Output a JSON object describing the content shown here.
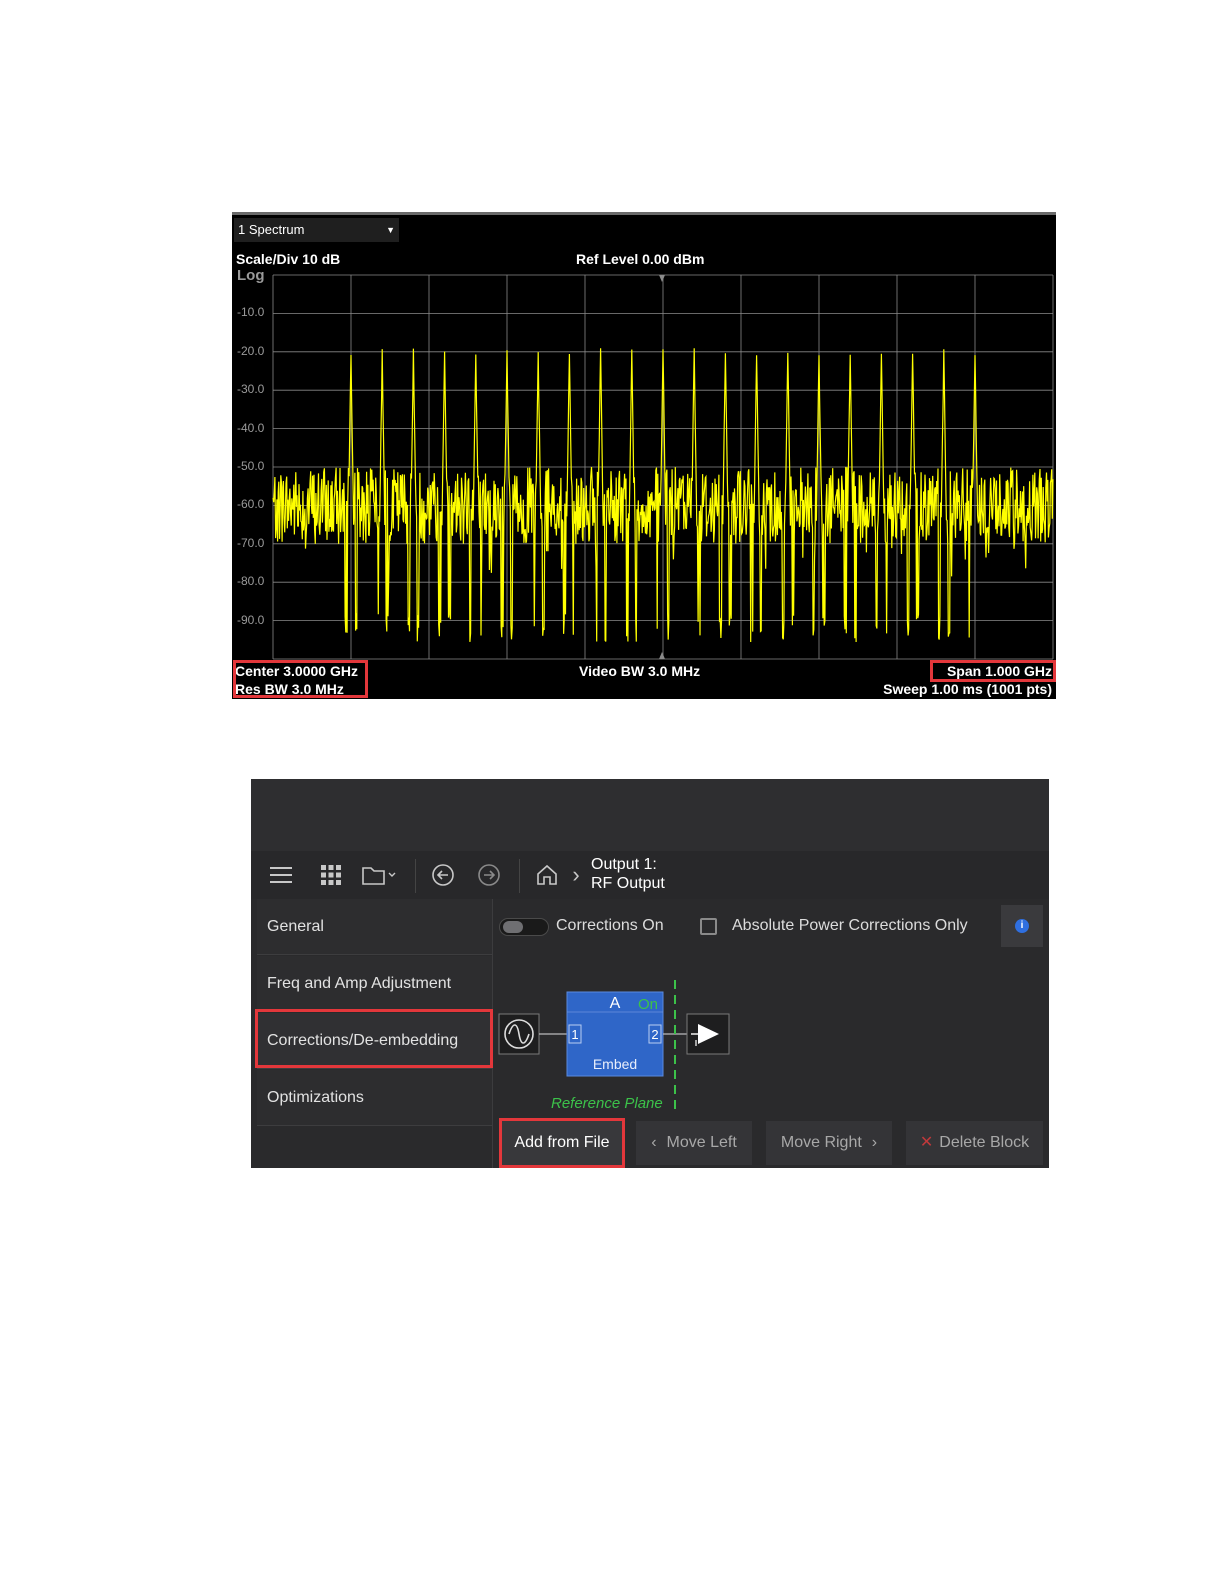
{
  "spectrum": {
    "window_label": "1 Spectrum",
    "scale_label": "Scale/Div 10 dB",
    "log_label": "Log",
    "ref_level_label": "Ref Level 0.00 dBm",
    "y_ticks": [
      "-10.0",
      "-20.0",
      "-30.0",
      "-40.0",
      "-50.0",
      "-60.0",
      "-70.0",
      "-80.0",
      "-90.0"
    ],
    "center_label": "Center 3.0000 GHz",
    "res_bw_label": "Res BW 3.0 MHz",
    "video_bw_label": "Video BW 3.0 MHz",
    "span_label": "Span 1.000 GHz",
    "sweep_label": "Sweep 1.00 ms (1001 pts)",
    "trace_color": "#ffff00",
    "grid_color": "#8a8a8a",
    "highlight_color": "#e3373b"
  },
  "chart_data": {
    "type": "line",
    "ylim": [
      -100,
      0
    ],
    "xlim": [
      2.5,
      3.5
    ],
    "x_unit": "GHz",
    "y_unit": "dBm",
    "noise_floor_dbm": [
      -70,
      -90
    ],
    "tones": {
      "count": 21,
      "peak_dbm": -21,
      "x_ghz": [
        2.6,
        2.64,
        2.68,
        2.72,
        2.76,
        2.8,
        2.84,
        2.88,
        2.92,
        2.96,
        3.0,
        3.04,
        3.08,
        3.12,
        3.16,
        3.2,
        3.24,
        3.28,
        3.32,
        3.36,
        3.4
      ]
    }
  },
  "corrections_ui": {
    "toolbar": {
      "menu_icon": "hamburger-menu-icon",
      "apps_icon": "apps-grid-icon",
      "folder_icon": "folder-icon",
      "back_icon": "back-arrow-icon",
      "forward_icon": "forward-arrow-icon",
      "home_icon": "home-icon",
      "breadcrumb_chevron": "›",
      "title_line1": "Output 1:",
      "title_line2": "RF Output"
    },
    "sidebar": {
      "items": [
        {
          "label": "General"
        },
        {
          "label": "Freq and Amp Adjustment"
        },
        {
          "label": "Corrections/De-embedding"
        },
        {
          "label": "Optimizations"
        }
      ]
    },
    "corrections_toggle_label": "Corrections On",
    "abs_power_label": "Absolute Power Corrections Only",
    "block": {
      "name": "A",
      "state": "On",
      "port1": "1",
      "port2": "2",
      "type_label": "Embed",
      "fill_color": "#2f66c8",
      "state_color": "#3cc24a"
    },
    "reference_plane_label": "Reference Plane",
    "reference_plane_color": "#3cc24a",
    "buttons": {
      "add_from_file": "Add from File",
      "move_left": "Move Left",
      "move_right": "Move Right",
      "delete_block": "Delete Block"
    }
  }
}
